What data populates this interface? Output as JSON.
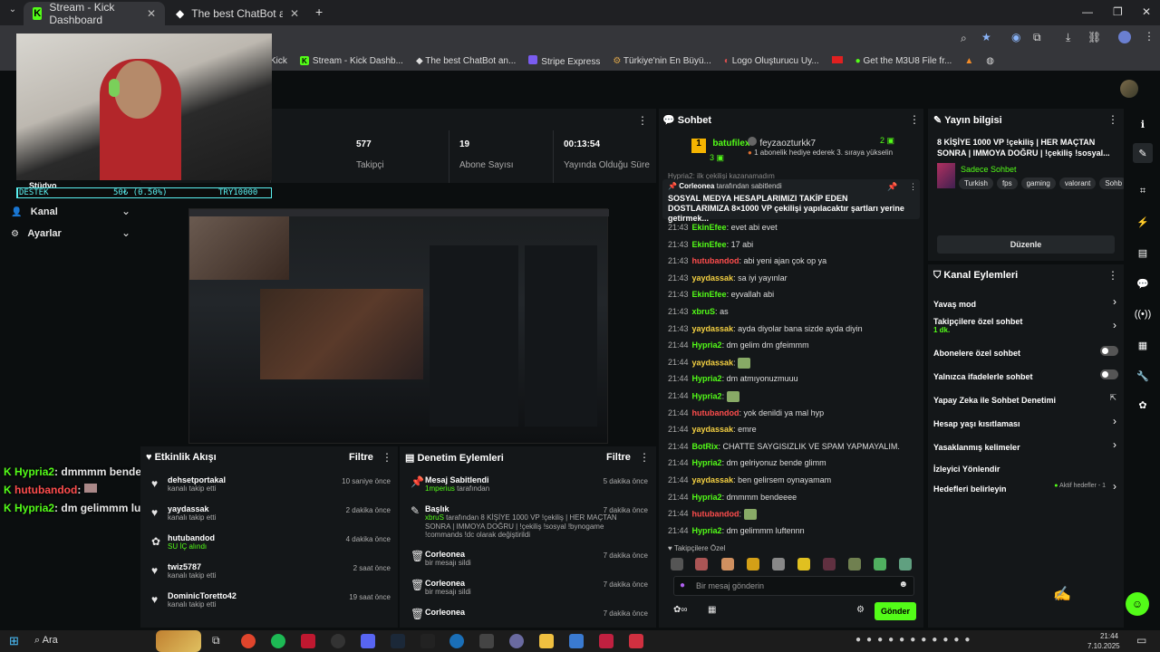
{
  "browser": {
    "tabs": [
      {
        "title": "Stream - Kick Dashboard"
      },
      {
        "title": "The best ChatBot and Widgets"
      }
    ],
    "bookmarks": [
      "Kick",
      "Stream - Kick Dashb...",
      "The best ChatBot an...",
      "Stripe Express",
      "Türkiye'nin En Büyü...",
      "Logo Oluşturucu Uy...",
      "Get the M3U8 File fr..."
    ]
  },
  "webcam_overlay": {
    "label": "DESTEK",
    "progress_text": "50₺ (0.50%)",
    "goal_text": "TRY10000",
    "progress": 0.005,
    "partial_label": "Stüdyo"
  },
  "left_nav": {
    "items": [
      {
        "label": "Kanal"
      },
      {
        "label": "Ayarlar"
      }
    ]
  },
  "stats": [
    {
      "value": "577",
      "label": "Takipçi"
    },
    {
      "value": "19",
      "label": "Abone Sayısı"
    },
    {
      "value": "00:13:54",
      "label": "Yayında Olduğu Süre"
    }
  ],
  "overlay_chat": [
    {
      "user": "Hypria2",
      "text": ": dmmmm bendeeee",
      "color": "green"
    },
    {
      "user": "hutubandod",
      "text": ":",
      "color": "red"
    },
    {
      "user": "Hypria2",
      "text": ": dm gelimmm luftennn",
      "color": "green"
    }
  ],
  "activity": {
    "title": "Etkinlik Akışı",
    "filter": "Filtre",
    "items": [
      {
        "user": "dehsetportakal",
        "desc": "kanalı takip etti",
        "time": "10 saniye önce"
      },
      {
        "user": "yaydassak",
        "desc": "kanalı takip etti",
        "time": "2 dakika önce"
      },
      {
        "user": "hutubandod",
        "desc": "SU İÇ alındı",
        "time": "4 dakika önce"
      },
      {
        "user": "twiz5787",
        "desc": "kanalı takip etti",
        "time": "2 saat önce"
      },
      {
        "user": "DominicToretto42",
        "desc": "kanalı takip etti",
        "time": "19 saat önce"
      }
    ]
  },
  "moderation": {
    "title": "Denetim Eylemleri",
    "filter": "Filtre",
    "items": [
      {
        "title": "Mesaj Sabitlendi",
        "user": "1mperius",
        "desc": "tarafından",
        "time": "5 dakika önce"
      },
      {
        "title": "Başlık",
        "user": "xbruS",
        "desc": "tarafından 8 KİŞİYE 1000 VP !çekiliş | HER MAÇTAN SONRA | IMMOYA DOĞRU | !çekiliş !sosyal !bynogame !commands !dc olarak değiştirildi",
        "time": "7 dakika önce"
      },
      {
        "title": "Corleonea",
        "user": "",
        "desc": "bir mesajı sildi",
        "time": "7 dakika önce"
      },
      {
        "title": "Corleonea",
        "user": "",
        "desc": "bir mesajı sildi",
        "time": "7 dakika önce"
      },
      {
        "title": "Corleonea",
        "user": "",
        "desc": "",
        "time": "7 dakika önce"
      }
    ]
  },
  "chat": {
    "title": "Sohbet",
    "top_gifter": {
      "rank": "1",
      "user": "batufilex",
      "count": "3"
    },
    "gift_user": "feyzaozturkk7",
    "gift_count": "2",
    "gift_text": "1 abonelik hediye ederek 3. sıraya yükselin",
    "partial_top": "Hypria2: ilk çekilişi kazanamadım",
    "pinned": {
      "by_user": "Corleonea",
      "by_text": "tarafından sabitlendi",
      "text": "SOSYAL MEDYA HESAPLARIMIZI TAKİP EDEN DOSTLARIMIZA 8×1000 VP çekilişi yapılacaktır şartları yerine getirmek..."
    },
    "messages": [
      {
        "time": "21:43",
        "user": "EkinEfee",
        "text": "evet abi evet",
        "color": "green"
      },
      {
        "time": "21:43",
        "user": "EkinEfee",
        "text": "17 abi",
        "color": "green"
      },
      {
        "time": "21:43",
        "user": "hutubandod",
        "text": "abi yeni ajan çok op ya",
        "color": "red"
      },
      {
        "time": "21:43",
        "user": "yaydassak",
        "text": "sa iyi yayınlar",
        "color": "yellow"
      },
      {
        "time": "21:43",
        "user": "EkinEfee",
        "text": "eyvallah abi",
        "color": "green"
      },
      {
        "time": "21:43",
        "user": "xbruS",
        "text": "as",
        "color": "green"
      },
      {
        "time": "21:43",
        "user": "yaydassak",
        "text": "ayda diyolar bana sizde ayda diyin",
        "color": "yellow"
      },
      {
        "time": "21:44",
        "user": "Hypria2",
        "text": "dm gelim dm gfeimmm",
        "color": "green"
      },
      {
        "time": "21:44",
        "user": "yaydassak",
        "text": "",
        "color": "yellow"
      },
      {
        "time": "21:44",
        "user": "Hypria2",
        "text": "dm atmıyonuzmuuu",
        "color": "green"
      },
      {
        "time": "21:44",
        "user": "Hypria2",
        "text": "",
        "color": "green"
      },
      {
        "time": "21:44",
        "user": "hutubandod",
        "text": "yok denildi ya mal hyp",
        "color": "red"
      },
      {
        "time": "21:44",
        "user": "yaydassak",
        "text": "emre",
        "color": "yellow"
      },
      {
        "time": "21:44",
        "user": "BotRix",
        "text": "CHATTE SAYGISIZLIK VE SPAM YAPMAYALIM.",
        "color": "green"
      },
      {
        "time": "21:44",
        "user": "Hypria2",
        "text": "dm gelriyonuz bende glimm",
        "color": "green"
      },
      {
        "time": "21:44",
        "user": "yaydassak",
        "text": "ben gelirsem oynayamam",
        "color": "yellow"
      },
      {
        "time": "21:44",
        "user": "Hypria2",
        "text": "dmmmm bendeeee",
        "color": "green"
      },
      {
        "time": "21:44",
        "user": "hutubandod",
        "text": "",
        "color": "red"
      },
      {
        "time": "21:44",
        "user": "Hypria2",
        "text": "dm gelimmm luftennn",
        "color": "green"
      }
    ],
    "followers_only": "Takipçilere Özel",
    "input_placeholder": "Bir mesaj gönderin",
    "send": "Gönder"
  },
  "stream_info": {
    "header": "Yayın bilgisi",
    "title": "8 KİŞİYE 1000 VP !çekiliş | HER MAÇTAN SONRA | IMMOYA DOĞRU | !çekiliş !sosyal...",
    "category": "Sadece Sohbet",
    "tags": [
      "Turkish",
      "fps",
      "gaming",
      "valorant",
      "Sohb"
    ],
    "edit": "Düzenle"
  },
  "channel_actions": {
    "header": "Kanal Eylemleri",
    "items": [
      {
        "label": "Yavaş mod",
        "sub": "",
        "control": "chevron"
      },
      {
        "label": "Takipçilere özel sohbet",
        "sub": "1 dk.",
        "control": "chevron"
      },
      {
        "label": "Abonelere özel sohbet",
        "sub": "",
        "control": "toggle"
      },
      {
        "label": "Yalnızca ifadelerle sohbet",
        "sub": "",
        "control": "toggle"
      },
      {
        "label": "Yapay Zeka ile Sohbet Denetimi",
        "sub": "",
        "control": "external"
      },
      {
        "label": "Hesap yaşı kısıtlaması",
        "sub": "",
        "control": "chevron"
      },
      {
        "label": "Yasaklanmış kelimeler",
        "sub": "",
        "control": "chevron"
      },
      {
        "label": "İzleyici Yönlendir",
        "sub": "",
        "control": "none"
      },
      {
        "label": "Hedefleri belirleyin",
        "sub": "",
        "control": "chevron",
        "extra": "Aktif hedefler - 1"
      }
    ]
  },
  "taskbar": {
    "search": "Ara",
    "time": "21:44",
    "date": "7.10.2025"
  },
  "colors": {
    "kick_green": "#53fc18",
    "panel": "#141719",
    "bg": "#0b0e0f"
  }
}
